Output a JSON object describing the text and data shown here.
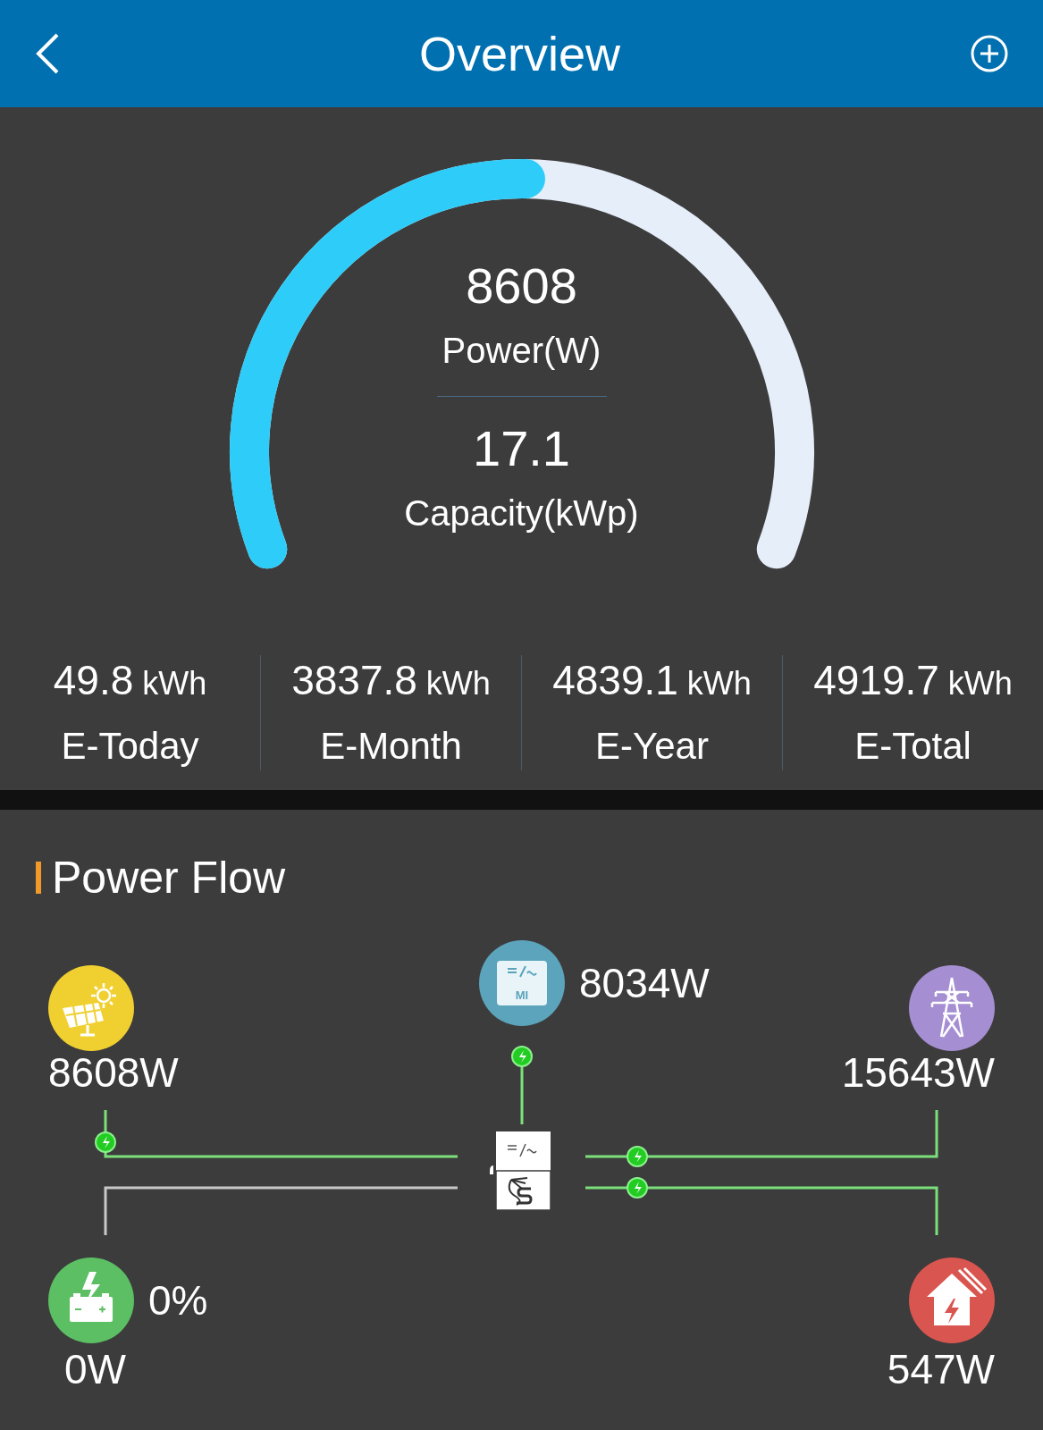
{
  "header": {
    "title": "Overview"
  },
  "gauge": {
    "value": "8608",
    "value_label": "Power(W)",
    "capacity": "17.1",
    "capacity_label": "Capacity(kWp)"
  },
  "stats": [
    {
      "value": "49.8",
      "unit": "kWh",
      "label": "E-Today"
    },
    {
      "value": "3837.8",
      "unit": "kWh",
      "label": "E-Month"
    },
    {
      "value": "4839.1",
      "unit": "kWh",
      "label": "E-Year"
    },
    {
      "value": "4919.7",
      "unit": "kWh",
      "label": "E-Total"
    }
  ],
  "power_flow": {
    "title": "Power Flow",
    "nodes": [
      {
        "kind": "solar",
        "reading": "8608W"
      },
      {
        "kind": "microinverter",
        "badge": "MI",
        "reading": "8034W"
      },
      {
        "kind": "grid",
        "reading": "15643W"
      },
      {
        "kind": "battery",
        "percent": "0%",
        "reading": "0W"
      },
      {
        "kind": "home",
        "reading": "547W"
      }
    ],
    "lines": [
      {
        "kind": "solar",
        "active": true
      },
      {
        "kind": "microinverter",
        "active": true
      },
      {
        "kind": "grid",
        "active": true
      },
      {
        "kind": "battery",
        "active": false
      },
      {
        "kind": "home",
        "active": true
      }
    ]
  }
}
